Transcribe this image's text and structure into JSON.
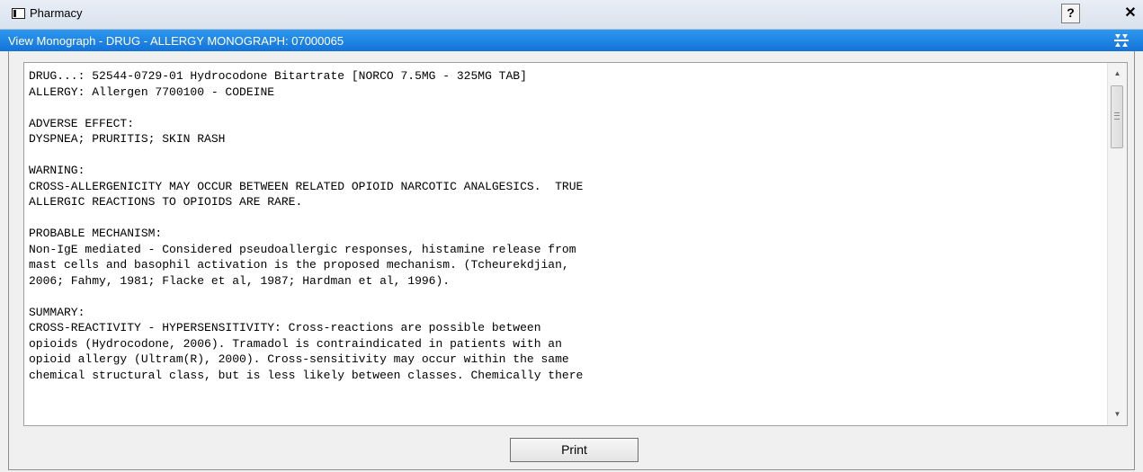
{
  "window": {
    "title": "Pharmacy",
    "help_label": "?",
    "close_label": "✕"
  },
  "dialog": {
    "title": "View Monograph - DRUG - ALLERGY MONOGRAPH: 07000065"
  },
  "monograph": {
    "lines": [
      "DRUG...: 52544-0729-01 Hydrocodone Bitartrate [NORCO 7.5MG - 325MG TAB]",
      "ALLERGY: Allergen 7700100 - CODEINE",
      "",
      "ADVERSE EFFECT:",
      "DYSPNEA; PRURITIS; SKIN RASH",
      "",
      "WARNING:",
      "CROSS-ALLERGENICITY MAY OCCUR BETWEEN RELATED OPIOID NARCOTIC ANALGESICS.  TRUE",
      "ALLERGIC REACTIONS TO OPIOIDS ARE RARE.",
      "",
      "PROBABLE MECHANISM:",
      "Non-IgE mediated - Considered pseudoallergic responses, histamine release from",
      "mast cells and basophil activation is the proposed mechanism. (Tcheurekdjian,",
      "2006; Fahmy, 1981; Flacke et al, 1987; Hardman et al, 1996).",
      "",
      "SUMMARY:",
      "CROSS-REACTIVITY - HYPERSENSITIVITY: Cross-reactions are possible between",
      "opioids (Hydrocodone, 2006). Tramadol is contraindicated in patients with an",
      "opioid allergy (Ultram(R), 2000). Cross-sensitivity may occur within the same",
      "chemical structural class, but is less likely between classes. Chemically there"
    ]
  },
  "scrollbar": {
    "up_arrow": "▲",
    "down_arrow": "▼"
  },
  "footer": {
    "print_label": "Print"
  },
  "colors": {
    "subbar": "#1a7fe4",
    "titlebar": "#dfe7f1"
  }
}
